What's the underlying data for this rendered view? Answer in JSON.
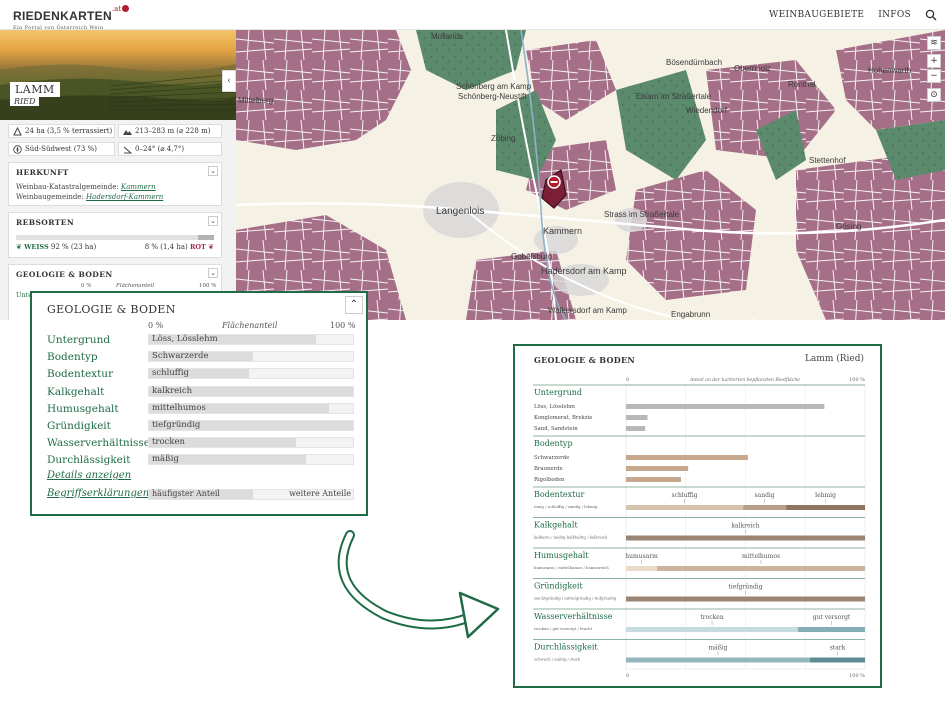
{
  "app": {
    "logo": "RIEDENKARTEN",
    "logo_suffix": ".at",
    "tagline": "Ein Portal von Österreich Wein",
    "nav": [
      "WEINBAUGEBIETE",
      "INFOS"
    ]
  },
  "ried": {
    "name": "LAMM",
    "type": "RIED",
    "stats": [
      "24 ha (3,5 % terrassiert)",
      "213–283 m (⌀ 228 m)",
      "Süd-Südwest (73 %)",
      "0–24° (⌀ 4,7°)"
    ]
  },
  "herkunft": {
    "title": "HERKUNFT",
    "kataster_label": "Weinbau-Katastralgemeinde:",
    "kataster_value": "Kammern",
    "gemeinde_label": "Weinbaugemeinde:",
    "gemeinde_value": "Hadersdorf-Kammern"
  },
  "rebsorten": {
    "title": "REBSORTEN",
    "weiss_label": "WEISS",
    "weiss_value": "92 % (23 ha)",
    "rot_value": "8 % (1,4 ha)",
    "rot_label": "ROT"
  },
  "sidebar_geo": {
    "title": "GEOLOGIE & BODEN",
    "scale_0": "0 %",
    "scale_mid": "Flächenanteil",
    "scale_100": "100 %",
    "first_row_partial": "Unter"
  },
  "map": {
    "labels": [
      "Mollands",
      "Schönberg am Kamp",
      "Schönberg-Neustift",
      "Zöbing",
      "Langenlois",
      "Kammern",
      "Gobelsburg",
      "Hadersdorf am Kamp",
      "Walkersdorf am Kamp",
      "Engabrunn",
      "Strass im Straßertale",
      "Elsarn im Straßertale",
      "Wiedendorf",
      "Obernholz",
      "Ronthal",
      "Stettenhof",
      "Gösing",
      "Hohenwarth",
      "Mittelberg",
      "Bösendürnbach"
    ]
  },
  "callout": {
    "title": "GEOLOGIE & BODEN",
    "scale_0": "0 %",
    "scale_mid": "Flächenanteil",
    "scale_100": "100 %",
    "rows": [
      {
        "label": "Untergrund",
        "value": "Löss, Lösslehm",
        "fill": 0.82
      },
      {
        "label": "Bodentyp",
        "value": "Schwarzerde",
        "fill": 0.51
      },
      {
        "label": "Bodentextur",
        "value": "schluffig",
        "fill": 0.49
      },
      {
        "label": "Kalkgehalt",
        "value": "kalkreich",
        "fill": 1.0
      },
      {
        "label": "Humusgehalt",
        "value": "mittelhumos",
        "fill": 0.88
      },
      {
        "label": "Gründigkeit",
        "value": "tiefgründig",
        "fill": 1.0
      },
      {
        "label": "Wasserverhältnisse",
        "value": "trocken",
        "fill": 0.72
      },
      {
        "label": "Durchlässigkeit",
        "value": "mäßig",
        "fill": 0.77
      }
    ],
    "details_link": "Details anzeigen",
    "glossary_link": "Begriffserklärungen",
    "legend_left": "häufigster Anteil",
    "legend_right": "weitere Anteile"
  },
  "panel": {
    "title": "GEOLOGIE & BODEN",
    "ried": "Lamm (Ried)",
    "scale_0": "0",
    "scale_caption": "Anteil an der kartierten bepflanzten Riedfläche",
    "scale_100": "100 %",
    "untergrund": {
      "label": "Untergrund",
      "items": [
        {
          "name": "Löss, Lösslehm",
          "value": 0.83
        },
        {
          "name": "Konglomerat, Brekzie",
          "value": 0.09
        },
        {
          "name": "Sand, Sandstein",
          "value": 0.08
        }
      ]
    },
    "bodentyp": {
      "label": "Bodentyp",
      "items": [
        {
          "name": "Schwarzerde",
          "value": 0.51
        },
        {
          "name": "Braunerde",
          "value": 0.26
        },
        {
          "name": "Rigolboden",
          "value": 0.23
        }
      ]
    },
    "scales": [
      {
        "label": "Bodentextur",
        "caption": "tonig / schluffig / sandig / lehmig",
        "segments": [
          {
            "from": 0,
            "to": 0.49,
            "name": "schluffig"
          },
          {
            "from": 0.49,
            "to": 0.67,
            "name": "sandig"
          },
          {
            "from": 0.67,
            "to": 1.0,
            "name": "lehmig"
          }
        ],
        "colors": [
          "#d6c3ae",
          "#b79f89",
          "#8f7462"
        ]
      },
      {
        "label": "Kalkgehalt",
        "caption": "kalkarm / mäßig kalkhaltig / kalkreich",
        "segments": [
          {
            "from": 0,
            "to": 1.0,
            "name": "kalkreich"
          }
        ],
        "colors": [
          "#9c8472"
        ]
      },
      {
        "label": "Humusgehalt",
        "caption": "humusarm / mittelhumos / humusreich",
        "segments": [
          {
            "from": 0,
            "to": 0.13,
            "name": "humusarm"
          },
          {
            "from": 0.13,
            "to": 1.0,
            "name": "mittelhumos"
          }
        ],
        "colors": [
          "#eadbc9",
          "#ccb39c"
        ]
      },
      {
        "label": "Gründigkeit",
        "caption": "seichtgründig / mittelgründig / tiefgründig",
        "segments": [
          {
            "from": 0,
            "to": 1.0,
            "name": "tiefgründig"
          }
        ],
        "colors": [
          "#9c8472"
        ]
      },
      {
        "label": "Wasserverhältnisse",
        "caption": "trocken / gut versorgt / feucht",
        "segments": [
          {
            "from": 0,
            "to": 0.72,
            "name": "trocken"
          },
          {
            "from": 0.72,
            "to": 1.0,
            "name": "gut versorgt"
          }
        ],
        "colors": [
          "#c6dbe0",
          "#84aeb6"
        ]
      },
      {
        "label": "Durchlässigkeit",
        "caption": "schwach / mäßig / stark",
        "segments": [
          {
            "from": 0,
            "to": 0.77,
            "name": "mäßig"
          },
          {
            "from": 0.77,
            "to": 1.0,
            "name": "stark"
          }
        ],
        "colors": [
          "#93b7bd",
          "#5e8c92"
        ]
      }
    ]
  },
  "colors": {
    "accent": "#1e6b46",
    "vineyard": "#a56f88",
    "forest": "#5c8a6d",
    "marker": "#b01c2e"
  }
}
